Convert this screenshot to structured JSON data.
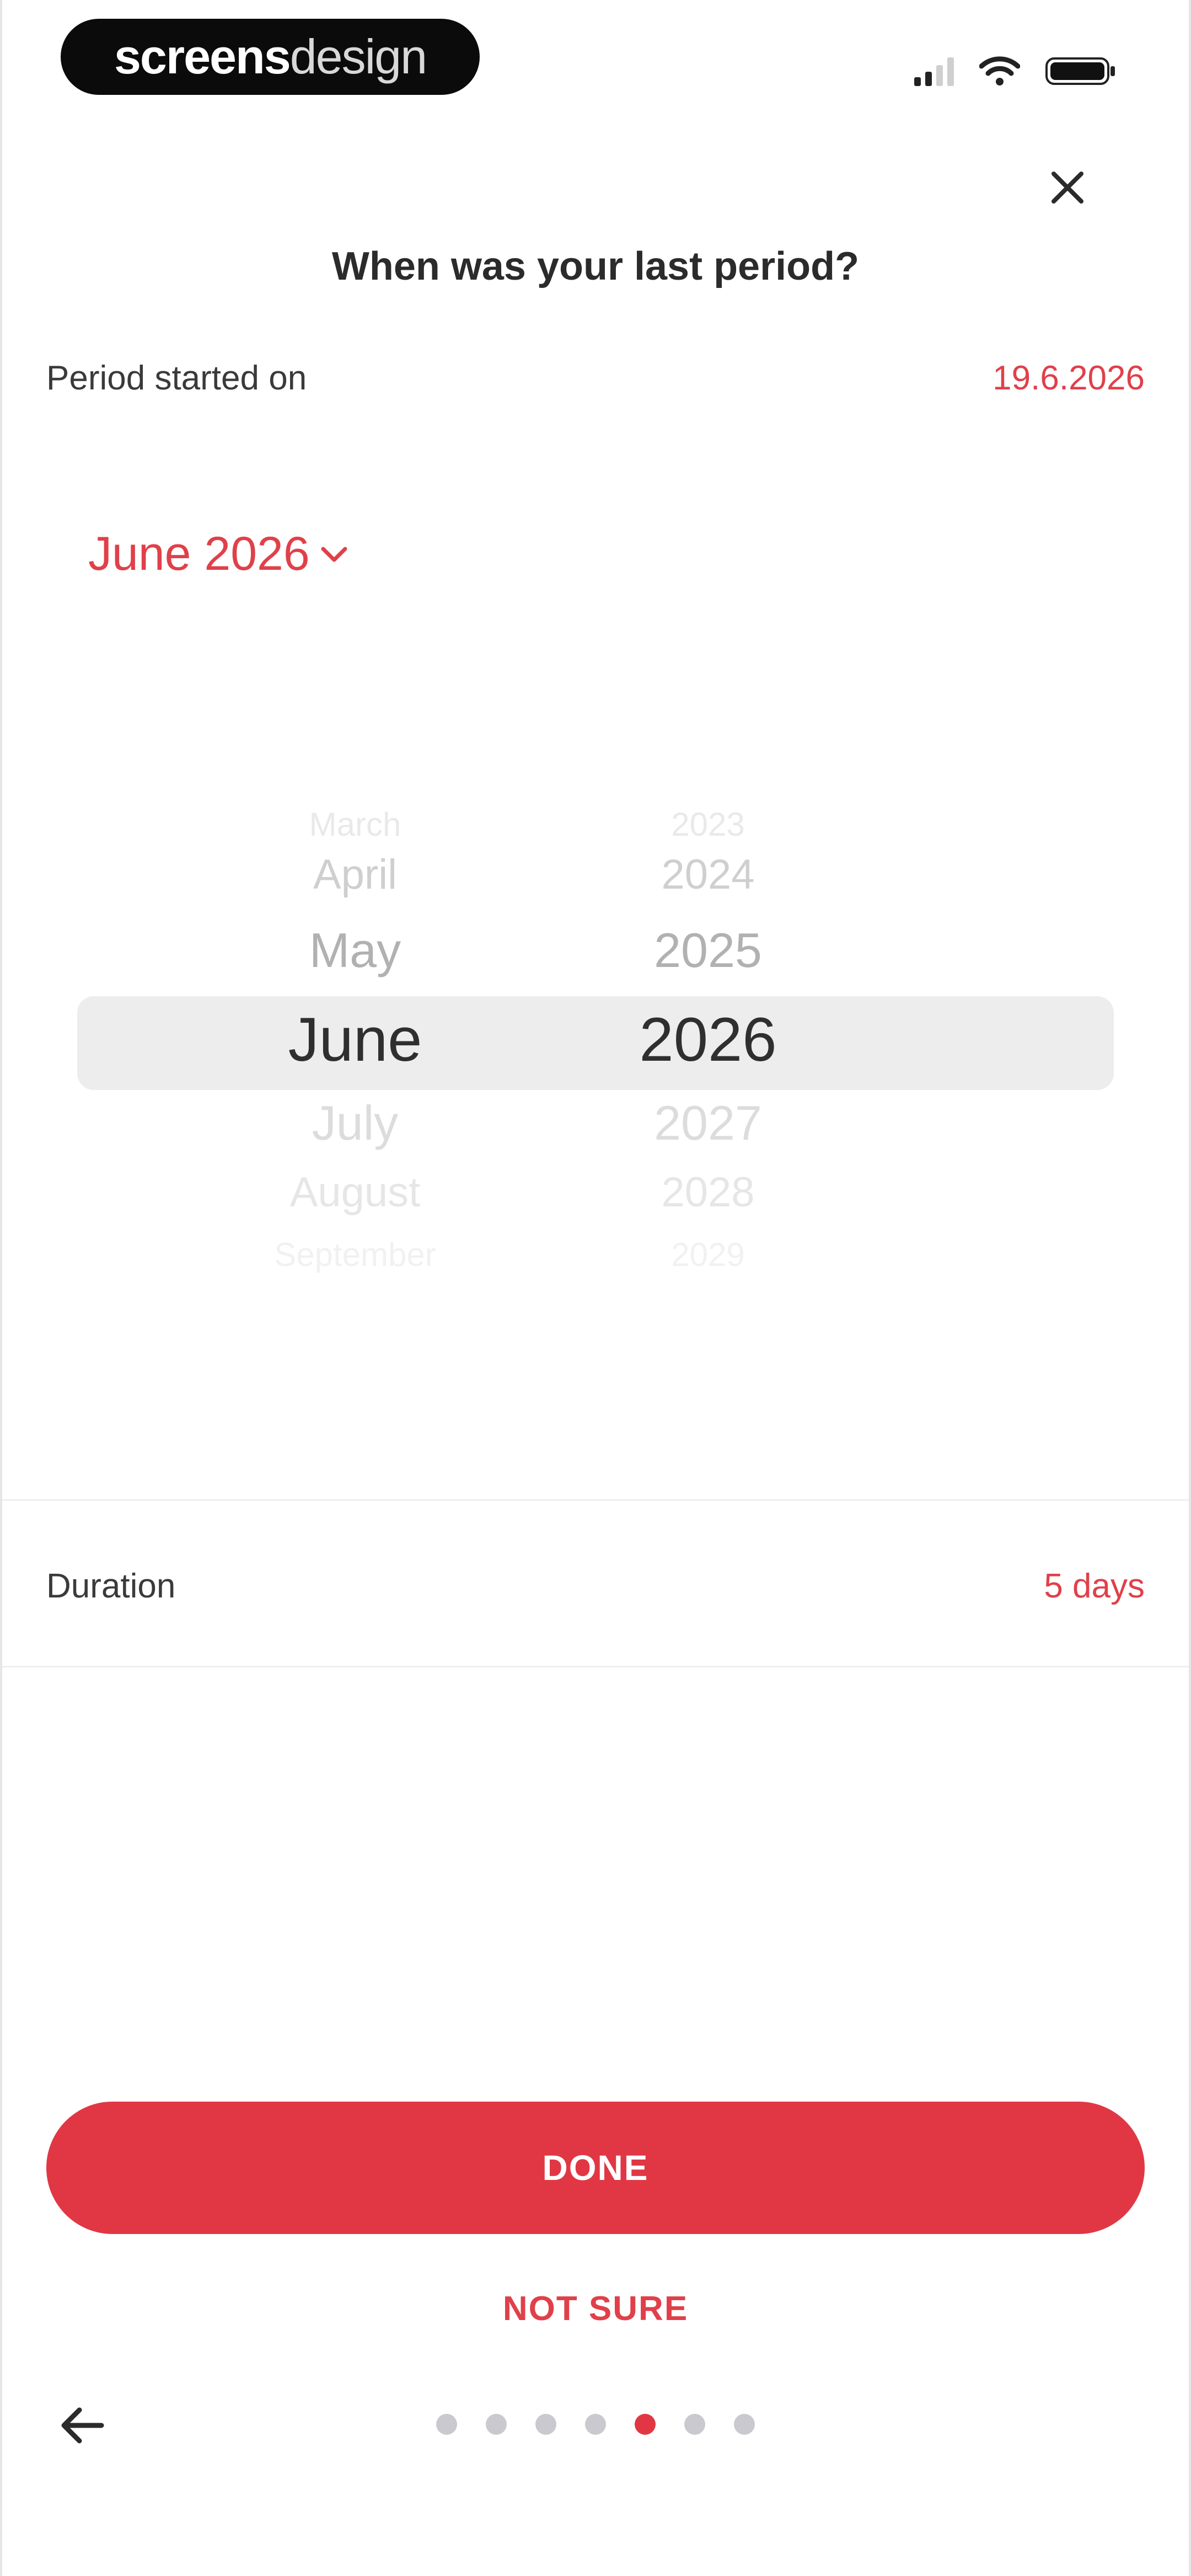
{
  "status_bar": {
    "brand_part1": "screens",
    "brand_part2": "design"
  },
  "header": {
    "title": "When was your last period?",
    "close_icon": "close-icon"
  },
  "period_start": {
    "label": "Period started on",
    "value": "19.6.2026"
  },
  "month_toggle": {
    "label": "June 2026",
    "icon": "chevron-down-icon"
  },
  "picker": {
    "months": [
      "March",
      "April",
      "May",
      "June",
      "July",
      "August",
      "September"
    ],
    "years": [
      "2023",
      "2024",
      "2025",
      "2026",
      "2027",
      "2028",
      "2029"
    ],
    "selected_month": "June",
    "selected_year": "2026"
  },
  "duration": {
    "label": "Duration",
    "value": "5 days"
  },
  "actions": {
    "done_label": "DONE",
    "not_sure_label": "NOT SURE"
  },
  "pagination": {
    "total": 7,
    "active_index": 4,
    "back_icon": "arrow-left-icon"
  },
  "colors": {
    "accent": "#e13744",
    "accent_text": "#e0404a",
    "highlight": "#ededee",
    "dot_inactive": "#c9c9cf"
  }
}
